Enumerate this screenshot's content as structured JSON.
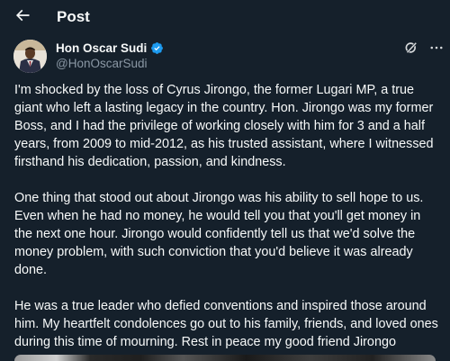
{
  "header": {
    "title": "Post"
  },
  "icons": {
    "back": "arrow-left-icon",
    "verified": "verified-badge-icon",
    "grok": "grok-icon",
    "more": "more-dots-icon"
  },
  "colors": {
    "background": "#15202b",
    "text_primary": "#f7f9f9",
    "text_secondary": "#8b98a5",
    "verified_blue": "#1d9bf0"
  },
  "post": {
    "author_name": "Hon Oscar Sudi",
    "author_handle": "@HonOscarSudi",
    "paragraphs": [
      "I'm shocked by the loss of Cyrus Jirongo, the former Lugari MP, a true giant who left a lasting legacy in the country. Hon. Jirongo was my former Boss, and I had the privilege of working closely with him for 3 and a half years, from 2009 to mid-2012, as his trusted assistant, where I witnessed firsthand his dedication, passion, and kindness.",
      "One thing that stood out about Jirongo was his ability to sell hope to us. Even when he had no money, he would tell you that you'll get money in the next one hour. Jirongo would confidently tell us that we'd solve the money problem, with such conviction that you'd believe it was already done.",
      "He was a true leader who defied conventions and inspired those around him. My heartfelt condolences go out to his family, friends, and loved ones during this time of mourning. Rest in peace my good friend Jirongo"
    ]
  }
}
